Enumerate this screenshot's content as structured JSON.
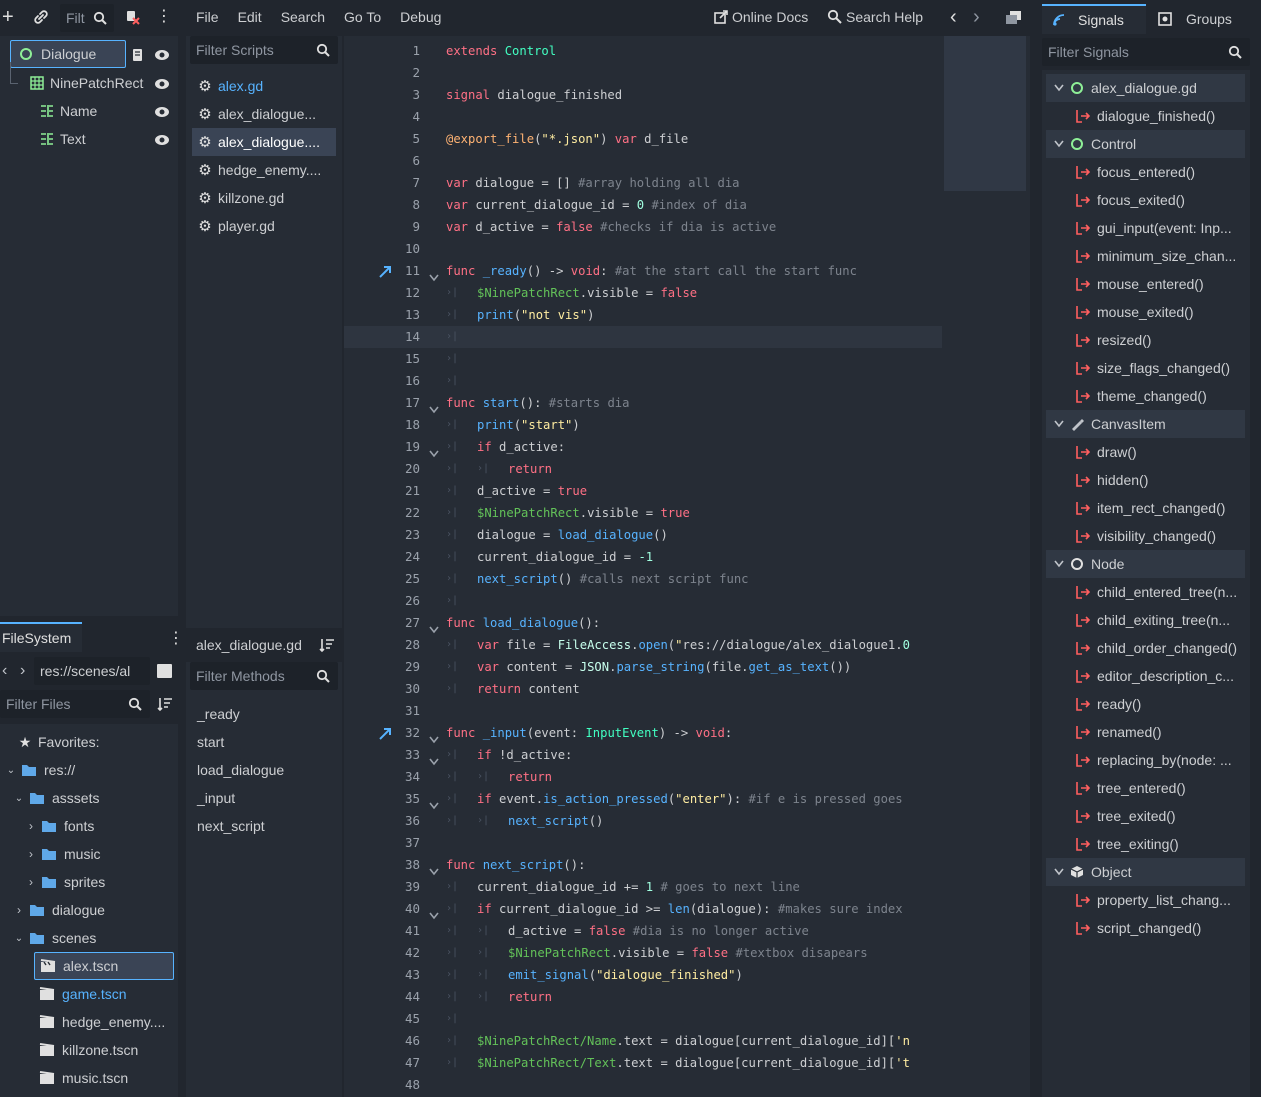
{
  "scene_tree": {
    "filter_placeholder": "Filt",
    "nodes": [
      {
        "label": "Dialogue",
        "type": "control"
      },
      {
        "label": "NinePatchRect",
        "type": "ninepatch"
      },
      {
        "label": "Name",
        "type": "label"
      },
      {
        "label": "Text",
        "type": "label"
      }
    ]
  },
  "filesystem": {
    "tab_label": "FileSystem",
    "path": "res://scenes/al",
    "filter_placeholder": "Filter Files",
    "favorites_label": "Favorites:",
    "items": [
      {
        "label": "res://"
      },
      {
        "label": "asssets"
      },
      {
        "label": "fonts"
      },
      {
        "label": "music"
      },
      {
        "label": "sprites"
      },
      {
        "label": "dialogue"
      },
      {
        "label": "scenes"
      },
      {
        "label": "alex.tscn"
      },
      {
        "label": "game.tscn"
      },
      {
        "label": "hedge_enemy...."
      },
      {
        "label": "killzone.tscn"
      },
      {
        "label": "music.tscn"
      }
    ]
  },
  "menu": {
    "file": "File",
    "edit": "Edit",
    "search": "Search",
    "goto": "Go To",
    "debug": "Debug",
    "online_docs": "Online Docs",
    "search_help": "Search Help"
  },
  "scripts": {
    "filter_placeholder": "Filter Scripts",
    "items": [
      {
        "label": "alex.gd"
      },
      {
        "label": "alex_dialogue..."
      },
      {
        "label": "alex_dialogue...."
      },
      {
        "label": "hedge_enemy...."
      },
      {
        "label": "killzone.gd"
      },
      {
        "label": "player.gd"
      }
    ],
    "current_script": "alex_dialogue.gd",
    "methods_filter_placeholder": "Filter Methods",
    "methods": [
      "_ready",
      "start",
      "load_dialogue",
      "_input",
      "next_script"
    ]
  },
  "code": {
    "line_numbers": [
      "1",
      "2",
      "3",
      "4",
      "5",
      "6",
      "7",
      "8",
      "9",
      "10",
      "11",
      "12",
      "13",
      "14",
      "15",
      "16",
      "17",
      "18",
      "19",
      "20",
      "21",
      "22",
      "23",
      "24",
      "25",
      "26",
      "27",
      "28",
      "29",
      "30",
      "31",
      "32",
      "33",
      "34",
      "35",
      "36",
      "37",
      "38",
      "39",
      "40",
      "41",
      "42",
      "43",
      "44",
      "45",
      "46",
      "47",
      "48"
    ],
    "lines": [
      "extends Control",
      "",
      "signal dialogue_finished",
      "",
      "@export_file(\"*.json\") var d_file",
      "",
      "var dialogue = [] #array holding all dia",
      "var current_dialogue_id = 0 #index of dia",
      "var d_active = false #checks if dia is active",
      "",
      "func _ready() -> void: #at the start call the start func",
      "$NinePatchRect.visible = false",
      "print(\"not vis\")",
      "",
      "",
      "",
      "func start(): #starts dia",
      "print(\"start\")",
      "if d_active:",
      "return",
      "d_active = true",
      "$NinePatchRect.visible = true",
      "dialogue = load_dialogue()",
      "current_dialogue_id = -1",
      "next_script() #calls next script func",
      "",
      "func load_dialogue():",
      "var file = FileAccess.open(\"res://dialogue/alex_dialogue1.0",
      "var content = JSON.parse_string(file.get_as_text())",
      "return content",
      "",
      "func _input(event: InputEvent) -> void:",
      "if !d_active:",
      "return",
      "if event.is_action_pressed(\"enter\"): #if e is pressed goes",
      "next_script()",
      "",
      "func next_script():",
      "current_dialogue_id += 1 # goes to next line",
      "if current_dialogue_id >= len(dialogue): #makes sure index",
      "d_active = false #dia is no longer active",
      "$NinePatchRect.visible = false #textbox disapears",
      "emit_signal(\"dialogue_finished\")",
      "return",
      "",
      "$NinePatchRect/Name.text = dialogue[current_dialogue_id]['n",
      "$NinePatchRect/Text.text = dialogue[current_dialogue_id]['t",
      ""
    ]
  },
  "signals": {
    "tab_signals": "Signals",
    "tab_groups": "Groups",
    "filter_placeholder": "Filter Signals",
    "rows": [
      {
        "label": "alex_dialogue.gd",
        "header": true,
        "icon": "script"
      },
      {
        "label": "dialogue_finished()"
      },
      {
        "label": "Control",
        "header": true,
        "icon": "control"
      },
      {
        "label": "focus_entered()"
      },
      {
        "label": "focus_exited()"
      },
      {
        "label": "gui_input(event: Inp..."
      },
      {
        "label": "minimum_size_chan..."
      },
      {
        "label": "mouse_entered()"
      },
      {
        "label": "mouse_exited()"
      },
      {
        "label": "resized()"
      },
      {
        "label": "size_flags_changed()"
      },
      {
        "label": "theme_changed()"
      },
      {
        "label": "CanvasItem",
        "header": true,
        "icon": "canvas"
      },
      {
        "label": "draw()"
      },
      {
        "label": "hidden()"
      },
      {
        "label": "item_rect_changed()"
      },
      {
        "label": "visibility_changed()"
      },
      {
        "label": "Node",
        "header": true,
        "icon": "node"
      },
      {
        "label": "child_entered_tree(n..."
      },
      {
        "label": "child_exiting_tree(n..."
      },
      {
        "label": "child_order_changed()"
      },
      {
        "label": "editor_description_c..."
      },
      {
        "label": "ready()"
      },
      {
        "label": "renamed()"
      },
      {
        "label": "replacing_by(node: ..."
      },
      {
        "label": "tree_entered()"
      },
      {
        "label": "tree_exited()"
      },
      {
        "label": "tree_exiting()"
      },
      {
        "label": "Object",
        "header": true,
        "icon": "object"
      },
      {
        "label": "property_list_chang..."
      },
      {
        "label": "script_changed()"
      }
    ]
  },
  "colors": {
    "background": "#21262e",
    "panel": "#262c35",
    "accent": "#57b3ff",
    "keyword": "#ff7085",
    "string": "#ffeda1",
    "node_path": "#63c259",
    "signal_icon": "#ff5f5f"
  }
}
